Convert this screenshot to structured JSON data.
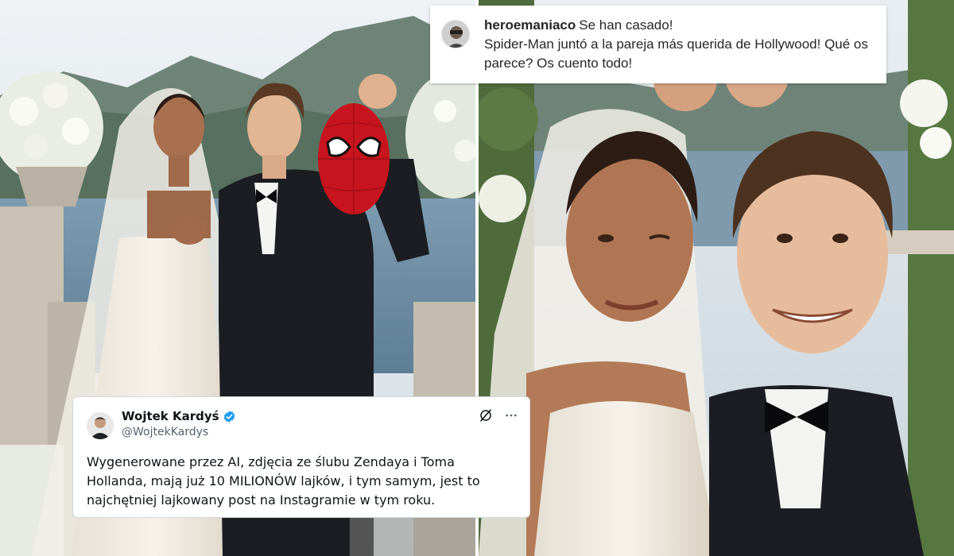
{
  "instagram_post": {
    "username": "heroemaniaco",
    "caption_line1": "Se han casado!",
    "caption_line2": "Spider-Man juntó a la pareja más querida de Hollywood! Qué os parece? Os cuento todo!"
  },
  "tweet": {
    "display_name": "Wojtek Kardyś",
    "handle": "@WojtekKardys",
    "text": "Wygenerowane przez AI, zdjęcia ze ślubu Zendaya i Toma Hollanda, mają już 10 MILIONÓW lajków, i tym samym, jest to najchętniej lajkowany post na Instagramie w tym roku.",
    "more_icon": "more-horizontal-icon",
    "grok_icon": "slash-circle-icon",
    "verified_icon": "verified-badge-icon"
  },
  "colors": {
    "twitter_verified": "#1d9bf0",
    "twitter_text": "#0f1419",
    "twitter_muted": "#536471",
    "spiderman_red": "#c8141e"
  }
}
